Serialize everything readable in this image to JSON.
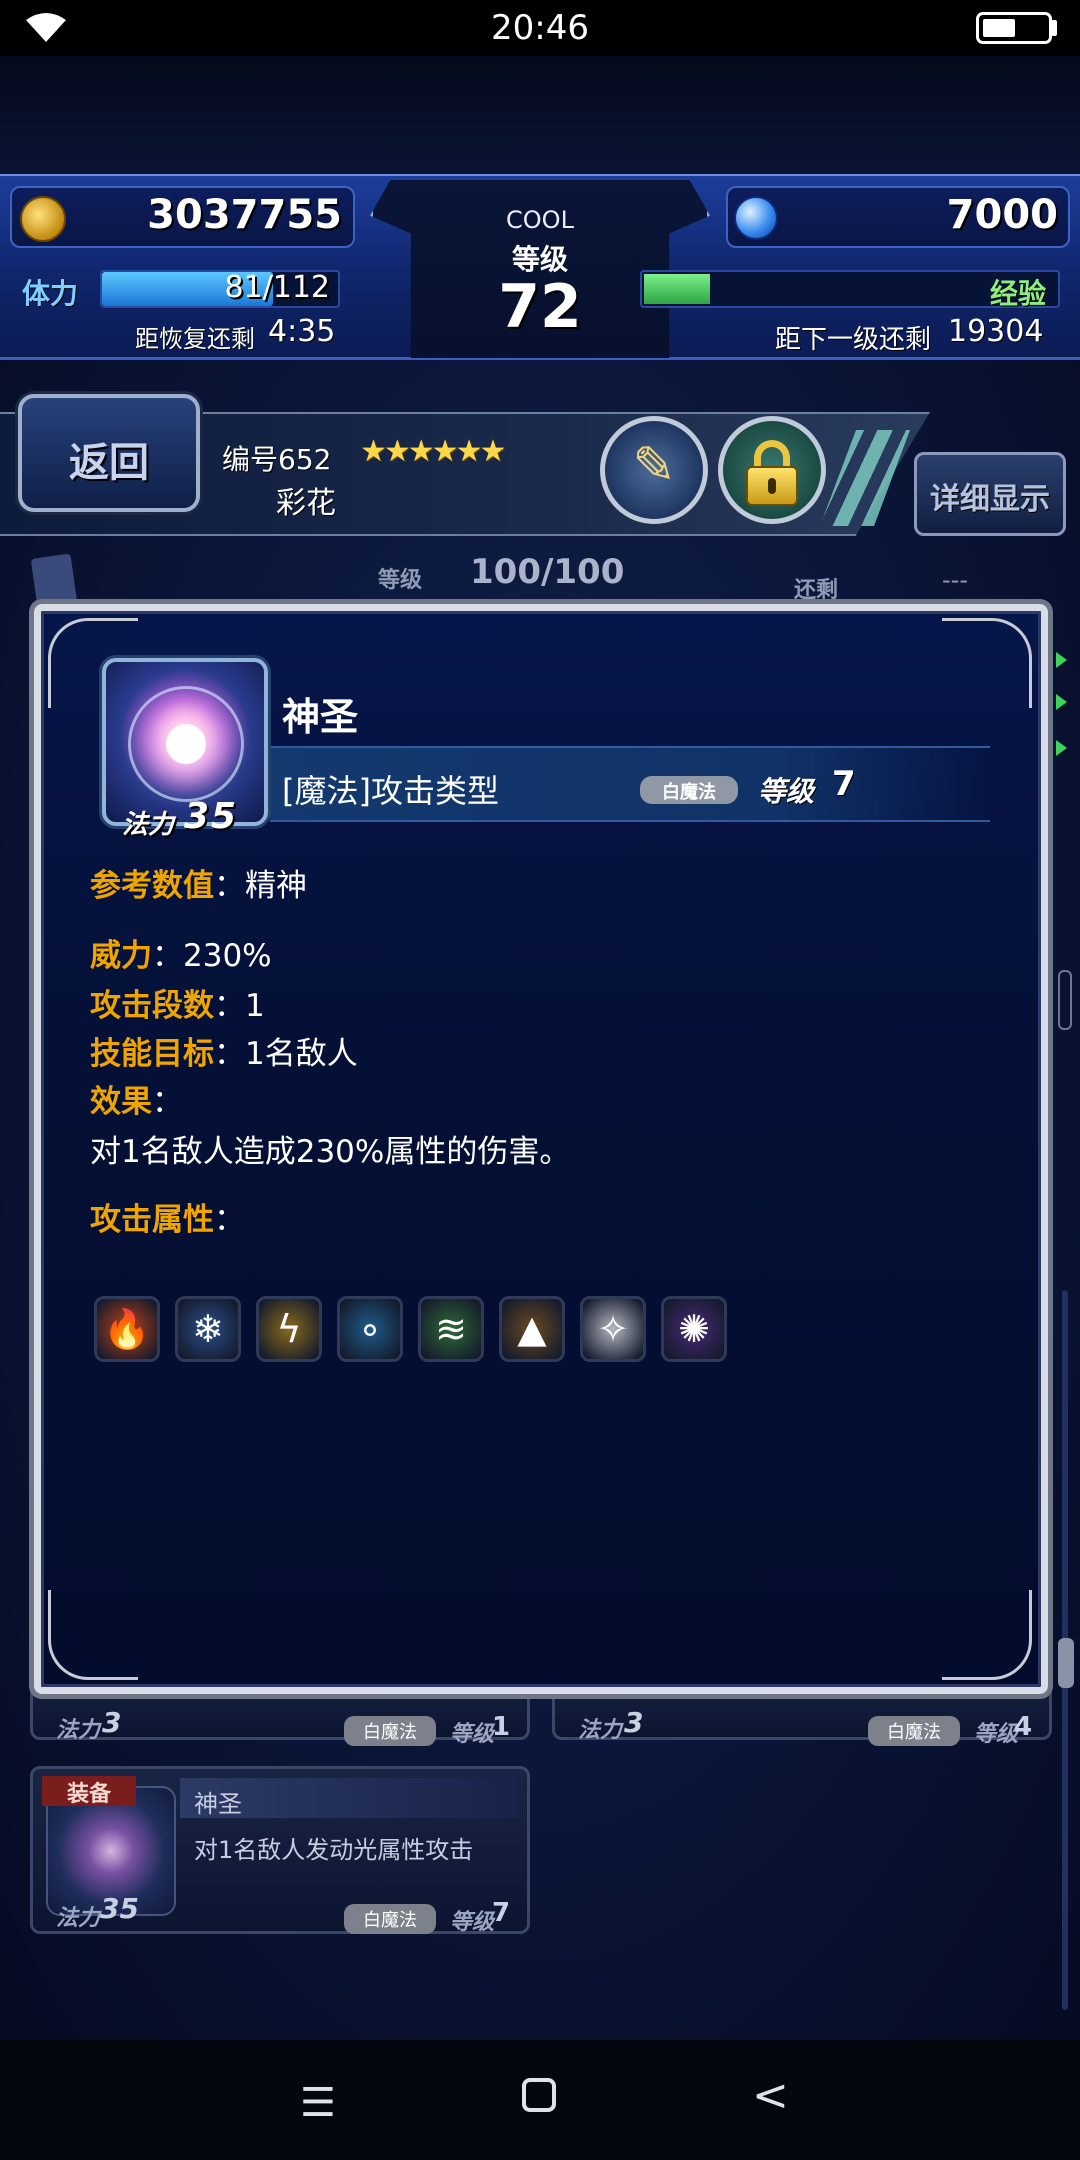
{
  "status": {
    "time": "20:46"
  },
  "header": {
    "gil": "3037755",
    "gems": "7000",
    "rank_title": "COOL",
    "rank_label": "等级",
    "rank": "72",
    "stamina_label": "体力",
    "stamina": "81/112",
    "recover_label": "距恢复还剩",
    "recover_time": "4:35",
    "exp_label": "经验",
    "next_label": "距下一级还剩",
    "next_value": "19304",
    "stamina_fraction": 0.723,
    "exp_fraction": 0.16
  },
  "unit": {
    "back_label": "返回",
    "number": "编号652",
    "stars": "★★★★★★",
    "name": "彩花",
    "detail_label": "详细显示"
  },
  "background": {
    "level_label": "等级",
    "level_value": "100/100",
    "remain_label": "还剩",
    "remain_value": "---",
    "cards": [
      {
        "mana_label": "法力",
        "mana": "3",
        "badge": "白魔法",
        "level_label": "等级",
        "level": "1"
      },
      {
        "mana_label": "法力",
        "mana": "3",
        "badge": "白魔法",
        "level_label": "等级",
        "level": "4"
      },
      {
        "equip": "装备",
        "title": "神圣",
        "desc": "对1名敌人发动光属性攻击",
        "mana_label": "法力",
        "mana": "35",
        "badge": "白魔法",
        "level_label": "等级",
        "level": "7"
      }
    ]
  },
  "skill": {
    "mana_label": "法力",
    "mana": "35",
    "name": "神圣",
    "type": "[魔法]攻击类型",
    "badge": "白魔法",
    "level_label": "等级",
    "level": "7",
    "ref_label": "参考数值",
    "ref_value": "精神",
    "power_label": "威力",
    "power_value": "230%",
    "hits_label": "攻击段数",
    "hits_value": "1",
    "target_label": "技能目标",
    "target_value": "1名敌人",
    "effect_label": "效果",
    "effect_text": "对1名敌人造成230%属性的伤害。",
    "element_label": "攻击属性",
    "colon": "：",
    "elements": [
      {
        "name": "fire",
        "icon": "fire-element-icon",
        "color": "#c0431a",
        "glyph": "🔥"
      },
      {
        "name": "ice",
        "icon": "ice-element-icon",
        "color": "#2b4f8a",
        "glyph": "❄"
      },
      {
        "name": "lightning",
        "icon": "lightning-element-icon",
        "color": "#8a6a1c",
        "glyph": "ϟ"
      },
      {
        "name": "water",
        "icon": "water-element-icon",
        "color": "#1f5d8a",
        "glyph": "∘"
      },
      {
        "name": "wind",
        "icon": "wind-element-icon",
        "color": "#2f6a35",
        "glyph": "≋"
      },
      {
        "name": "earth",
        "icon": "earth-element-icon",
        "color": "#6a4a22",
        "glyph": "▲"
      },
      {
        "name": "holy",
        "icon": "holy-element-icon",
        "color": "#b5b8c2",
        "glyph": "✧"
      },
      {
        "name": "dark",
        "icon": "dark-element-icon",
        "color": "#4a2a78",
        "glyph": "✺"
      }
    ]
  }
}
